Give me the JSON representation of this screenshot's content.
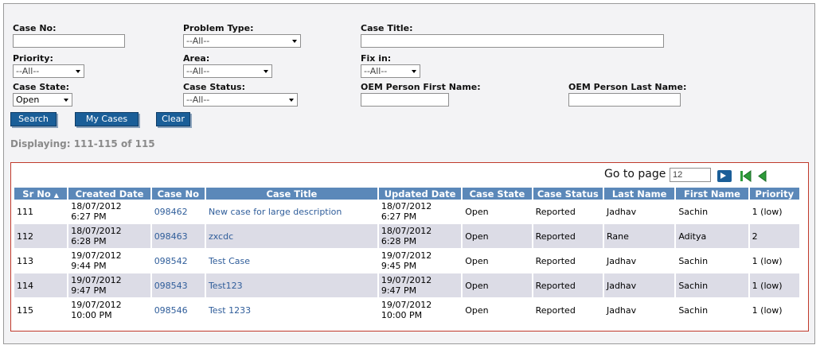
{
  "filters": {
    "case_no": {
      "label": "Case No:",
      "value": ""
    },
    "problem_type": {
      "label": "Problem Type:",
      "value": "--All--"
    },
    "case_title": {
      "label": "Case Title:",
      "value": ""
    },
    "priority": {
      "label": "Priority:",
      "value": "--All--"
    },
    "area": {
      "label": "Area:",
      "value": "--All--"
    },
    "fix_in": {
      "label": "Fix in:",
      "value": "--All--"
    },
    "case_state": {
      "label": "Case State:",
      "value": "Open"
    },
    "case_status": {
      "label": "Case Status:",
      "value": "--All--"
    },
    "oem_first": {
      "label": "OEM Person First Name:",
      "value": ""
    },
    "oem_last": {
      "label": "OEM Person Last Name:",
      "value": ""
    }
  },
  "buttons": {
    "search": "Search",
    "my_cases": "My Cases",
    "clear": "Clear"
  },
  "displaying": "Displaying: 111-115 of 115",
  "pager": {
    "goto_label": "Go to page",
    "page_value": "12"
  },
  "columns": [
    "Sr No",
    "Created Date",
    "Case No",
    "Case Title",
    "Updated Date",
    "Case State",
    "Case Status",
    "Last Name",
    "First Name",
    "Priority"
  ],
  "sort_indicator": "▲",
  "rows": [
    {
      "sr": "111",
      "created_date": "18/07/2012",
      "created_time": "6:27 PM",
      "case_no": "098462",
      "title": "New case for large description",
      "updated_date": "18/07/2012",
      "updated_time": "6:27 PM",
      "state": "Open",
      "status": "Reported",
      "last": "Jadhav",
      "first": "Sachin",
      "priority": "1 (low)"
    },
    {
      "sr": "112",
      "created_date": "18/07/2012",
      "created_time": "6:28 PM",
      "case_no": "098463",
      "title": "zxcdc",
      "updated_date": "18/07/2012",
      "updated_time": "6:28 PM",
      "state": "Open",
      "status": "Reported",
      "last": "Rane",
      "first": "Aditya",
      "priority": "2"
    },
    {
      "sr": "113",
      "created_date": "19/07/2012",
      "created_time": "9:44 PM",
      "case_no": "098542",
      "title": "Test Case",
      "updated_date": "19/07/2012",
      "updated_time": "9:45 PM",
      "state": "Open",
      "status": "Reported",
      "last": "Jadhav",
      "first": "Sachin",
      "priority": "1 (low)"
    },
    {
      "sr": "114",
      "created_date": "19/07/2012",
      "created_time": "9:47 PM",
      "case_no": "098543",
      "title": "Test123",
      "updated_date": "19/07/2012",
      "updated_time": "9:47 PM",
      "state": "Open",
      "status": "Reported",
      "last": "Jadhav",
      "first": "Sachin",
      "priority": "1 (low)"
    },
    {
      "sr": "115",
      "created_date": "19/07/2012",
      "created_time": "10:00 PM",
      "case_no": "098546",
      "title": "Test 1233",
      "updated_date": "19/07/2012",
      "updated_time": "10:00 PM",
      "state": "Open",
      "status": "Reported",
      "last": "Jadhav",
      "first": "Sachin",
      "priority": "1 (low)"
    }
  ],
  "colors": {
    "header_bg": "#5b88b9",
    "button_bg": "#1a5e98",
    "row_alt": "#dcdce6",
    "border_red": "#c0392b",
    "link": "#2f5d9a"
  },
  "icons": {
    "go": "arrow-right-icon",
    "first": "first-page-icon",
    "prev": "previous-page-icon"
  }
}
